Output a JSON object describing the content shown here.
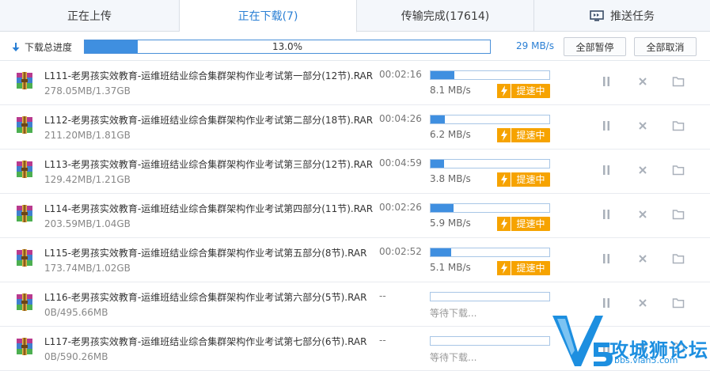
{
  "tabs": [
    {
      "label": "正在上传",
      "active": false
    },
    {
      "label": "正在下载(7)",
      "active": true
    },
    {
      "label": "传输完成(17614)",
      "active": false
    },
    {
      "label": "推送任务",
      "active": false,
      "icon": "push-screen-icon"
    }
  ],
  "summary": {
    "label": "下载总进度",
    "progress_text": "13.0%",
    "progress": 0.13,
    "speed": "29 MB/s",
    "pause_all": "全部暂停",
    "cancel_all": "全部取消"
  },
  "colors": {
    "accent": "#2a7fd4",
    "progress_fill": "#3f8fe0",
    "boost": "#f6a300"
  },
  "boost_label": "提速中",
  "waiting_label": "等待下载...",
  "files": [
    {
      "name": "L111-老男孩实效教育-运维班结业综合集群架构作业考试第一部分(12节).RAR",
      "size": "278.05MB/1.37GB",
      "eta": "00:02:16",
      "speed": "8.1 MB/s",
      "progress": 0.2,
      "status": "downloading"
    },
    {
      "name": "L112-老男孩实效教育-运维班结业综合集群架构作业考试第二部分(18节).RAR",
      "size": "211.20MB/1.81GB",
      "eta": "00:04:26",
      "speed": "6.2 MB/s",
      "progress": 0.12,
      "status": "downloading"
    },
    {
      "name": "L113-老男孩实效教育-运维班结业综合集群架构作业考试第三部分(12节).RAR",
      "size": "129.42MB/1.21GB",
      "eta": "00:04:59",
      "speed": "3.8 MB/s",
      "progress": 0.11,
      "status": "downloading"
    },
    {
      "name": "L114-老男孩实效教育-运维班结业综合集群架构作业考试第四部分(11节).RAR",
      "size": "203.59MB/1.04GB",
      "eta": "00:02:26",
      "speed": "5.9 MB/s",
      "progress": 0.19,
      "status": "downloading"
    },
    {
      "name": "L115-老男孩实效教育-运维班结业综合集群架构作业考试第五部分(8节).RAR",
      "size": "173.74MB/1.02GB",
      "eta": "00:02:52",
      "speed": "5.1 MB/s",
      "progress": 0.17,
      "status": "downloading"
    },
    {
      "name": "L116-老男孩实效教育-运维班结业综合集群架构作业考试第六部分(5节).RAR",
      "size": "0B/495.66MB",
      "eta": "--",
      "speed": "",
      "progress": 0,
      "status": "waiting"
    },
    {
      "name": "L117-老男孩实效教育-运维班结业综合集群架构作业考试第七部分(6节).RAR",
      "size": "0B/590.26MB",
      "eta": "--",
      "speed": "",
      "progress": 0,
      "status": "waiting"
    }
  ],
  "watermark": {
    "title": "攻城狮论坛",
    "url": "bbs.vlan5.com"
  }
}
